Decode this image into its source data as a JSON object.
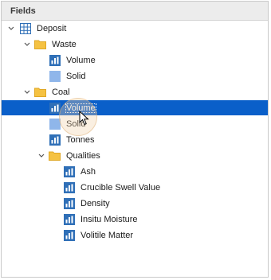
{
  "panel": {
    "title": "Fields"
  },
  "tree": {
    "deposit": "Deposit",
    "waste": "Waste",
    "waste_volume": "Volume",
    "waste_solid": "Solid",
    "coal": "Coal",
    "coal_volume": "Volume",
    "coal_solid": "Solid",
    "coal_tonnes": "Tonnes",
    "qualities": "Qualities",
    "q_ash": "Ash",
    "q_crucible": "Crucible Swell Value",
    "q_density": "Density",
    "q_moisture": "Insitu Moisture",
    "q_volatile": "Volitile Matter"
  },
  "colors": {
    "selection": "#0a5fc9",
    "folder": "#f5c242",
    "field_icon": "#2f6fb7",
    "solid_icon": "#8fb6ea"
  }
}
